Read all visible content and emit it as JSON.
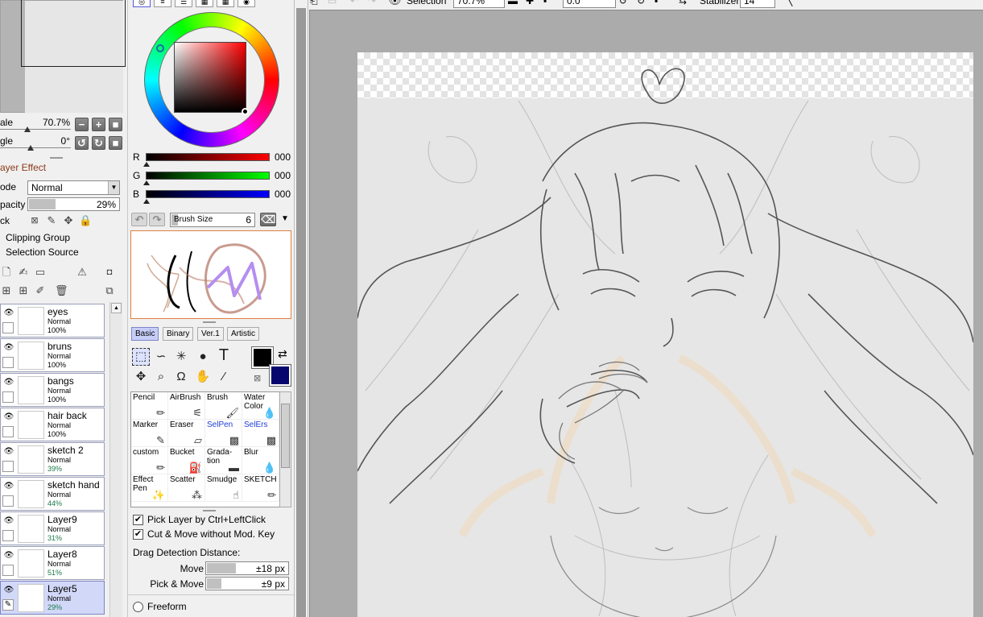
{
  "navigator": {
    "scale_label": "ale",
    "scale_value": "70.7%",
    "angle_label": "gle",
    "angle_value": "0°"
  },
  "layer_panel": {
    "section_title": "ayer Effect",
    "mode_label": "ode",
    "mode_value": "Normal",
    "opacity_label": "pacity",
    "opacity_value": "29%",
    "opacity_fraction": 0.29,
    "lock_label": "ck",
    "clipping_group": "Clipping Group",
    "selection_source": "Selection Source",
    "layers": [
      {
        "name": "eyes",
        "mode": "Normal",
        "opacity": "100%"
      },
      {
        "name": "bruns",
        "mode": "Normal",
        "opacity": "100%"
      },
      {
        "name": "bangs",
        "mode": "Normal",
        "opacity": "100%"
      },
      {
        "name": "hair back",
        "mode": "Normal",
        "opacity": "100%"
      },
      {
        "name": "sketch 2",
        "mode": "Normal",
        "opacity": "39%"
      },
      {
        "name": "sketch hand",
        "mode": "Normal",
        "opacity": "44%"
      },
      {
        "name": "Layer9",
        "mode": "Normal",
        "opacity": "31%"
      },
      {
        "name": "Layer8",
        "mode": "Normal",
        "opacity": "51%"
      },
      {
        "name": "Layer5",
        "mode": "Normal",
        "opacity": "29%"
      }
    ]
  },
  "color": {
    "r_label": "R",
    "r_value": "000",
    "g_label": "G",
    "g_value": "000",
    "b_label": "B",
    "b_value": "000",
    "foreground": "#000000",
    "background": "#06066e"
  },
  "brush": {
    "size_label": "Brush Size",
    "size_value": "6",
    "tabs": [
      "Basic",
      "Binary",
      "Ver.1",
      "Artistic"
    ],
    "active_tab": "Basic",
    "tools": [
      {
        "label": "Pencil",
        "icon": "pencil-icon"
      },
      {
        "label": "AirBrush",
        "icon": "airbrush-icon"
      },
      {
        "label": "Brush",
        "icon": "brush-icon"
      },
      {
        "label": "Water Color",
        "icon": "watercolor-icon"
      },
      {
        "label": "Marker",
        "icon": "marker-icon"
      },
      {
        "label": "Eraser",
        "icon": "eraser-icon"
      },
      {
        "label": "SelPen",
        "icon": "selpen-icon"
      },
      {
        "label": "SelErs",
        "icon": "selers-icon"
      },
      {
        "label": "custom",
        "icon": "pencil-icon"
      },
      {
        "label": "Bucket",
        "icon": "bucket-icon"
      },
      {
        "label": "Grada- tion",
        "icon": "gradation-icon"
      },
      {
        "label": "Blur",
        "icon": "blur-icon"
      },
      {
        "label": "Effect Pen",
        "icon": "effect-pen-icon"
      },
      {
        "label": "Scatter",
        "icon": "scatter-icon"
      },
      {
        "label": "Smudge",
        "icon": "smudge-icon"
      },
      {
        "label": "SKETCH",
        "icon": "pencil-icon"
      }
    ]
  },
  "options": {
    "pick_layer": "Pick Layer by Ctrl+LeftClick",
    "cut_move": "Cut & Move without Mod. Key",
    "drag_detection": "Drag Detection Distance:",
    "move_label": "Move",
    "move_value": "±18 px",
    "pick_move_label": "Pick & Move",
    "pick_move_value": "±9 px",
    "freeform": "Freeform"
  },
  "toolbar": {
    "selection_label": "Selection",
    "zoom_value": "70.7%",
    "angle_value": "0.0°",
    "stabilizer_label": "Stabilizer",
    "stabilizer_value": "14"
  }
}
